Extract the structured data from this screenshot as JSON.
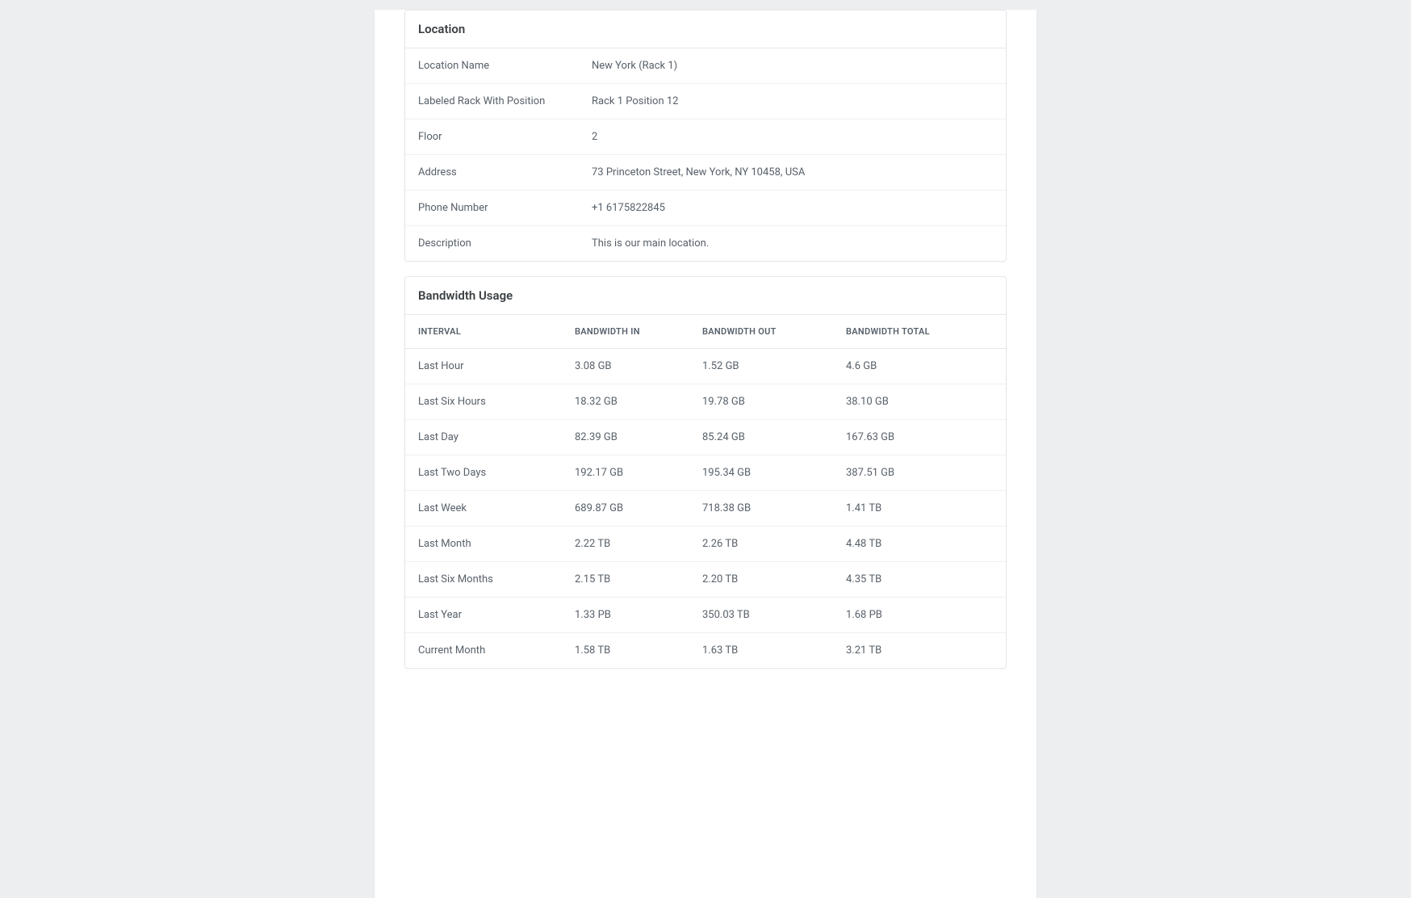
{
  "location": {
    "title": "Location",
    "rows": [
      {
        "label": "Location Name",
        "value": "New York (Rack 1)"
      },
      {
        "label": "Labeled Rack With Position",
        "value": "Rack 1 Position 12"
      },
      {
        "label": "Floor",
        "value": "2"
      },
      {
        "label": "Address",
        "value": "73 Princeton Street, New York, NY 10458, USA"
      },
      {
        "label": "Phone Number",
        "value": "+1 6175822845"
      },
      {
        "label": "Description",
        "value": "This is our main location."
      }
    ]
  },
  "bandwidth": {
    "title": "Bandwidth Usage",
    "columns": [
      "INTERVAL",
      "BANDWIDTH IN",
      "BANDWIDTH OUT",
      "BANDWIDTH TOTAL"
    ],
    "rows": [
      {
        "interval": "Last Hour",
        "in": "3.08 GB",
        "out": "1.52 GB",
        "total": "4.6 GB"
      },
      {
        "interval": "Last Six Hours",
        "in": "18.32 GB",
        "out": "19.78 GB",
        "total": "38.10 GB"
      },
      {
        "interval": "Last Day",
        "in": "82.39 GB",
        "out": "85.24 GB",
        "total": "167.63 GB"
      },
      {
        "interval": "Last Two Days",
        "in": "192.17 GB",
        "out": "195.34 GB",
        "total": "387.51 GB"
      },
      {
        "interval": "Last Week",
        "in": "689.87 GB",
        "out": "718.38 GB",
        "total": "1.41 TB"
      },
      {
        "interval": "Last Month",
        "in": "2.22 TB",
        "out": "2.26 TB",
        "total": "4.48 TB"
      },
      {
        "interval": "Last Six Months",
        "in": "2.15 TB",
        "out": "2.20 TB",
        "total": "4.35 TB"
      },
      {
        "interval": "Last Year",
        "in": "1.33 PB",
        "out": "350.03 TB",
        "total": "1.68 PB"
      },
      {
        "interval": "Current Month",
        "in": "1.58 TB",
        "out": "1.63 TB",
        "total": "3.21 TB"
      }
    ]
  }
}
